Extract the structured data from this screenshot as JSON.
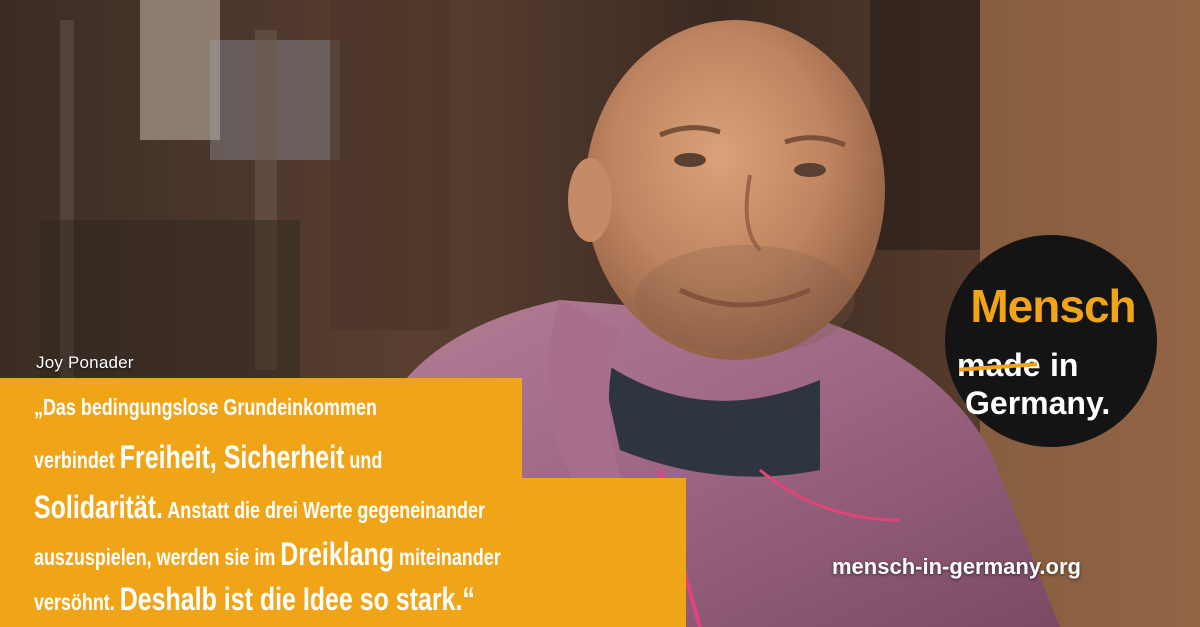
{
  "person": {
    "name": "Joy Ponader"
  },
  "quote": {
    "line1": [
      {
        "text": "„Das bedingungslose Grundeinkommen",
        "size": "small"
      }
    ],
    "line2": [
      {
        "text": "verbindet ",
        "size": "small"
      },
      {
        "text": "Freiheit, Sicherheit",
        "size": "big"
      },
      {
        "text": " und",
        "size": "small"
      }
    ],
    "line3": [
      {
        "text": "Solidarität.",
        "size": "big"
      },
      {
        "text": " Anstatt die drei Werte gegeneinander",
        "size": "small"
      }
    ],
    "line4": [
      {
        "text": "auszuspielen, werden sie im ",
        "size": "small"
      },
      {
        "text": "Dreiklang",
        "size": "big"
      },
      {
        "text": " miteinander",
        "size": "small"
      }
    ],
    "line5": [
      {
        "text": "versöhnt. ",
        "size": "small"
      },
      {
        "text": "Deshalb ist die Idee so stark.",
        "size": "big"
      },
      {
        "text": "“",
        "size": "big"
      }
    ]
  },
  "logo": {
    "word1": "Mensch",
    "word2_struck": "made",
    "word3": "in",
    "word4": "Germany."
  },
  "website": "mensch-in-germany.org",
  "colors": {
    "accent": "#f0a417",
    "logo_bg": "#141414",
    "text": "#ffffff"
  }
}
